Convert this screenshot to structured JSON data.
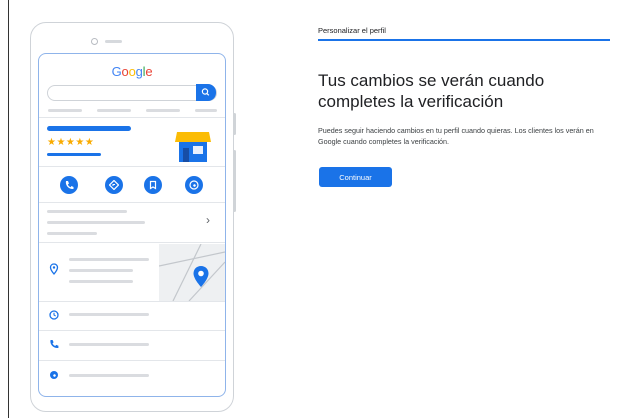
{
  "panel": {
    "title": "Personalizar el perfil",
    "headline": "Tus cambios se verán cuando completes la verificación",
    "description": "Puedes seguir haciendo cambios en tu perfil cuando quieras. Los clientes los verán en Google cuando completes la verificación.",
    "button_label": "Continuar"
  },
  "phone_preview": {
    "logo_letters": [
      "G",
      "o",
      "o",
      "g",
      "l",
      "e"
    ],
    "rating_stars": "★★★★★",
    "chevron": "›"
  },
  "colors": {
    "accent": "#1a73e8",
    "star": "#f9ab00",
    "logo": [
      "#4285f4",
      "#ea4335",
      "#fbbc05",
      "#4285f4",
      "#34a853",
      "#ea4335"
    ]
  },
  "icons": [
    "search-icon",
    "phone-icon",
    "directions-icon",
    "bookmark-icon",
    "globe-icon",
    "location-pin-icon",
    "map-pin-icon",
    "clock-icon",
    "storefront-icon",
    "chevron-right-icon"
  ]
}
